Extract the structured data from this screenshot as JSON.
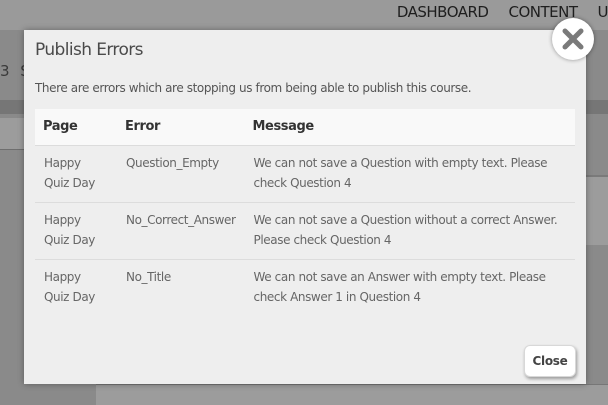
{
  "nav": {
    "items": [
      "DASHBOARD",
      "CONTENT",
      "U"
    ]
  },
  "background": {
    "fragment": "3 S"
  },
  "modal": {
    "title": "Publish Errors",
    "description": "There are errors which are stopping us from being able to publish this course.",
    "columns": {
      "page": "Page",
      "error": "Error",
      "message": "Message"
    },
    "rows": [
      {
        "page": "Happy Quiz Day",
        "error": "Question_Empty",
        "message": "We can not save a Question with empty text. Please check Question 4"
      },
      {
        "page": "Happy Quiz Day",
        "error": "No_Correct_Answer",
        "message": "We can not save a Question without a correct Answer. Please check Question 4"
      },
      {
        "page": "Happy Quiz Day",
        "error": "No_Title",
        "message": "We can not save an Answer with empty text. Please check Answer 1 in Question 4"
      }
    ],
    "close_label": "Close",
    "close_icon": "close-x-icon"
  }
}
